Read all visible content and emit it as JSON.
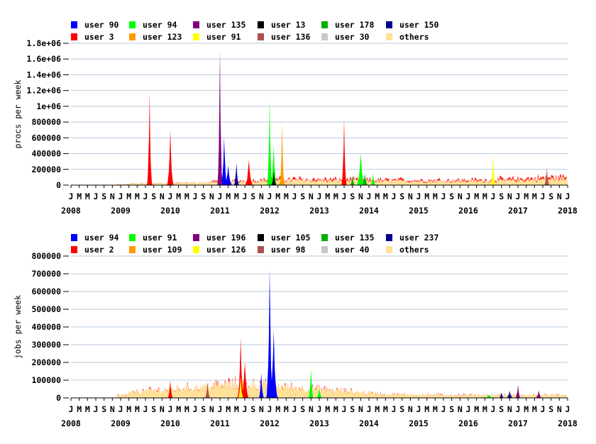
{
  "charts": [
    {
      "ylabel": "procs per week",
      "yticks": [
        "1.8e+06",
        "1.6e+06",
        "1.4e+06",
        "1.2e+06",
        "1e+06",
        "800000",
        "600000",
        "400000",
        "200000",
        "0"
      ],
      "legend": [
        {
          "label": "user 90",
          "color": "#0000ff"
        },
        {
          "label": "user 94",
          "color": "#00ff00"
        },
        {
          "label": "user 135",
          "color": "#800080"
        },
        {
          "label": "user 13",
          "color": "#000000"
        },
        {
          "label": "user 178",
          "color": "#00b000"
        },
        {
          "label": "user 150",
          "color": "#000090"
        },
        {
          "label": "user 3",
          "color": "#ff0000"
        },
        {
          "label": "user 123",
          "color": "#ff9900"
        },
        {
          "label": "user 91",
          "color": "#ffff00"
        },
        {
          "label": "user 136",
          "color": "#b05050"
        },
        {
          "label": "user 30",
          "color": "#c8c8c8"
        },
        {
          "label": "others",
          "color": "#ffe098"
        }
      ]
    },
    {
      "ylabel": "jobs per week",
      "yticks": [
        "800000",
        "700000",
        "600000",
        "500000",
        "400000",
        "300000",
        "200000",
        "100000",
        "0"
      ],
      "legend": [
        {
          "label": "user 94",
          "color": "#0000ff"
        },
        {
          "label": "user 91",
          "color": "#00ff00"
        },
        {
          "label": "user 196",
          "color": "#800080"
        },
        {
          "label": "user 105",
          "color": "#000000"
        },
        {
          "label": "user 135",
          "color": "#00b000"
        },
        {
          "label": "user 237",
          "color": "#000090"
        },
        {
          "label": "user 2",
          "color": "#ff0000"
        },
        {
          "label": "user 109",
          "color": "#ff9900"
        },
        {
          "label": "user 126",
          "color": "#ffff00"
        },
        {
          "label": "user 98",
          "color": "#b05050"
        },
        {
          "label": "user 40",
          "color": "#c8c8c8"
        },
        {
          "label": "others",
          "color": "#ffe098"
        }
      ]
    }
  ],
  "month_letters": [
    "J",
    "M",
    "M",
    "J",
    "S",
    "N"
  ],
  "end_month_letter": "J",
  "years": [
    "2008",
    "2009",
    "2010",
    "2011",
    "2012",
    "2013",
    "2014",
    "2015",
    "2016",
    "2017",
    "2018"
  ],
  "chart_data": [
    {
      "type": "area",
      "ylabel": "procs per week",
      "ylim": [
        0,
        1800000
      ],
      "x_range": [
        "2008-01",
        "2018-01"
      ],
      "grid": true,
      "stacked": true,
      "series": [
        {
          "name": "user 90",
          "color": "#0000ff",
          "points": [
            [
              "2011-01",
              1200000
            ],
            [
              "2011-02",
              600000
            ],
            [
              "2011-03",
              250000
            ],
            [
              "2011-05",
              280000
            ]
          ]
        },
        {
          "name": "user 94",
          "color": "#00ff00",
          "points": [
            [
              "2012-01",
              1110000
            ],
            [
              "2012-02",
              500000
            ],
            [
              "2013-11",
              400000
            ],
            [
              "2014-02",
              150000
            ]
          ]
        },
        {
          "name": "user 135",
          "color": "#800080",
          "points": [
            [
              "2011-01",
              1730000
            ]
          ]
        },
        {
          "name": "user 13",
          "color": "#000000",
          "points": [
            [
              "2012-02",
              180000
            ],
            [
              "2012-04",
              230000
            ]
          ]
        },
        {
          "name": "user 178",
          "color": "#00b000",
          "points": [
            [
              "2013-09",
              120000
            ],
            [
              "2013-12",
              150000
            ]
          ]
        },
        {
          "name": "user 150",
          "color": "#000090",
          "points": [
            [
              "2011-05",
              220000
            ]
          ]
        },
        {
          "name": "user 3",
          "color": "#ff0000",
          "points": [
            [
              "2009-08",
              1180000
            ],
            [
              "2010-01",
              700000
            ],
            [
              "2011-08",
              320000
            ],
            [
              "2013-07",
              850000
            ]
          ]
        },
        {
          "name": "user 123",
          "color": "#ff9900",
          "points": [
            [
              "2012-04",
              790000
            ]
          ]
        },
        {
          "name": "user 91",
          "color": "#ffff00",
          "points": [
            [
              "2016-07",
              390000
            ]
          ]
        },
        {
          "name": "user 136",
          "color": "#b05050",
          "points": [
            [
              "2017-08",
              220000
            ]
          ]
        },
        {
          "name": "user 30",
          "color": "#c8c8c8",
          "points": [
            [
              "2012-06",
              50000
            ]
          ]
        },
        {
          "name": "others",
          "color": "#ffe098",
          "points": [
            [
              "2009-03",
              20000
            ],
            [
              "2010-06",
              30000
            ],
            [
              "2012-06",
              60000
            ],
            [
              "2014-06",
              50000
            ],
            [
              "2016-06",
              50000
            ],
            [
              "2017-12",
              80000
            ]
          ]
        }
      ]
    },
    {
      "type": "area",
      "ylabel": "jobs per week",
      "ylim": [
        0,
        800000
      ],
      "x_range": [
        "2008-01",
        "2018-01"
      ],
      "grid": true,
      "stacked": true,
      "series": [
        {
          "name": "user 94",
          "color": "#0000ff",
          "points": [
            [
              "2011-11",
              140000
            ],
            [
              "2012-01",
              730000
            ],
            [
              "2012-02",
              380000
            ]
          ]
        },
        {
          "name": "user 91",
          "color": "#00ff00",
          "points": [
            [
              "2012-11",
              160000
            ],
            [
              "2013-01",
              50000
            ],
            [
              "2016-06",
              20000
            ]
          ]
        },
        {
          "name": "user 196",
          "color": "#800080",
          "points": [
            [
              "2017-01",
              75000
            ],
            [
              "2017-06",
              40000
            ]
          ]
        },
        {
          "name": "user 105",
          "color": "#000000",
          "points": [
            [
              "2011-06",
              150000
            ]
          ]
        },
        {
          "name": "user 135",
          "color": "#00b000",
          "points": [
            [
              "2010-01",
              50000
            ]
          ]
        },
        {
          "name": "user 237",
          "color": "#000090",
          "points": [
            [
              "2016-09",
              30000
            ],
            [
              "2016-11",
              40000
            ]
          ]
        },
        {
          "name": "user 2",
          "color": "#ff0000",
          "points": [
            [
              "2010-01",
              100000
            ],
            [
              "2011-06",
              340000
            ],
            [
              "2011-07",
              200000
            ]
          ]
        },
        {
          "name": "user 109",
          "color": "#ff9900",
          "points": [
            [
              "2010-10",
              80000
            ]
          ]
        },
        {
          "name": "user 126",
          "color": "#ffff00",
          "points": [
            [
              "2011-06",
              120000
            ]
          ]
        },
        {
          "name": "user 98",
          "color": "#b05050",
          "points": [
            [
              "2010-10",
              90000
            ]
          ]
        },
        {
          "name": "user 40",
          "color": "#c8c8c8",
          "points": [
            [
              "2012-06",
              10000
            ]
          ]
        },
        {
          "name": "others",
          "color": "#ffe098",
          "points": [
            [
              "2009-03",
              30000
            ],
            [
              "2011-06",
              80000
            ],
            [
              "2014-06",
              20000
            ],
            [
              "2016-06",
              15000
            ]
          ]
        }
      ]
    }
  ]
}
